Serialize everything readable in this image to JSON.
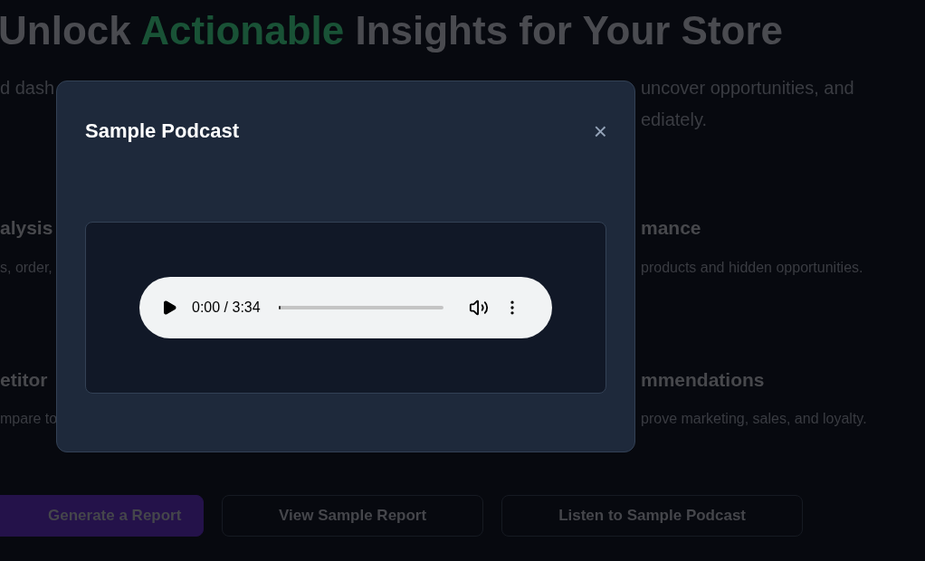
{
  "page": {
    "title": {
      "before": "Unlock ",
      "highlight": "Actionable",
      "after": " Insights for Your Store"
    },
    "subtitle": {
      "left": "d dash",
      "right_lines": [
        "uncover opportunities, and",
        "ediately."
      ]
    },
    "features": [
      {
        "left_title": "alysis",
        "left_text": "s, order,",
        "right_title": "mance",
        "right_text": "products and hidden opportunities."
      },
      {
        "left_title": "etitor",
        "left_text": "mpare to",
        "right_title": "mmendations",
        "right_text": "prove marketing, sales, and loyalty."
      }
    ],
    "buttons": [
      {
        "label": "Generate a Report",
        "kind": "primary"
      },
      {
        "label": "View Sample Report",
        "kind": "outline"
      },
      {
        "label": "Listen to Sample Podcast",
        "kind": "outline"
      }
    ]
  },
  "modal": {
    "title": "Sample Podcast",
    "close": "×",
    "player": {
      "time": "0:00 / 3:34",
      "level": 0.01
    }
  }
}
